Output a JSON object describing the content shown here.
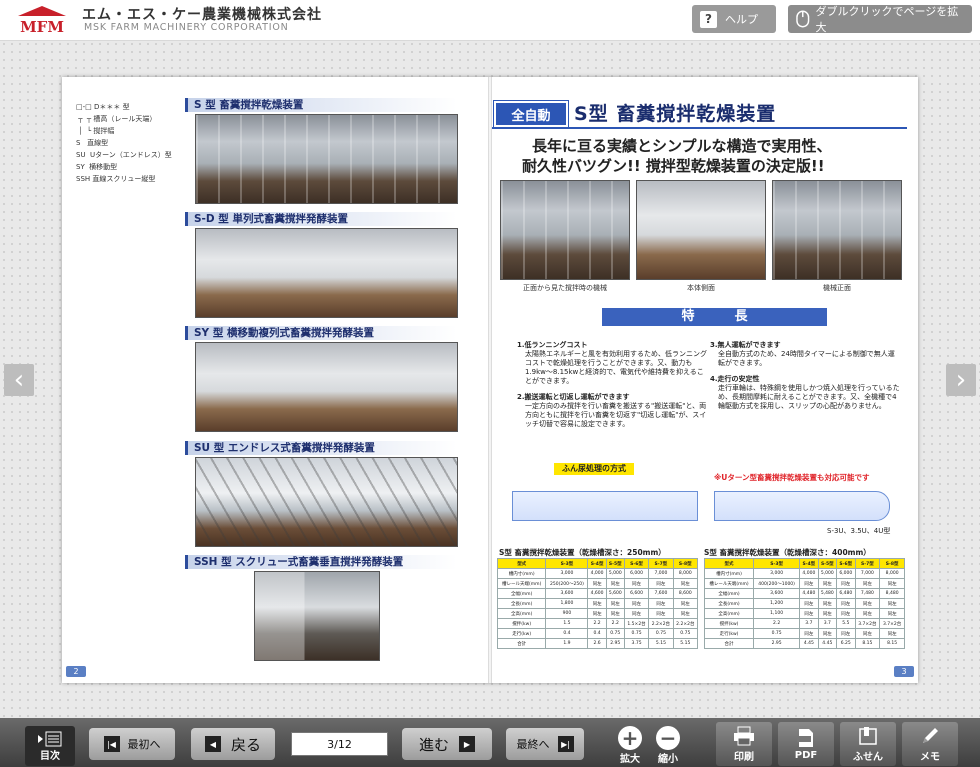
{
  "header": {
    "logo_text": "MFM",
    "company_jp": "エム・エス・ケー農業機械株式会社",
    "company_en": "MSK FARM MACHINERY CORPORATION",
    "help_label": "ヘルプ",
    "zoom_hint_label": "ダブルクリックでページを拡大",
    "colors": {
      "logo_red": "#c8202a",
      "button_gray": "#9a9a9a"
    }
  },
  "left_page": {
    "legend": "□-□ D＊＊＊ 型\n ┬  ┬ 槽高（レール天端）\n │  └ 撹拌幅\nS   直線型\nSU  Uターン（エンドレス）型\nSY  横移動型\nSSH 直線スクリュー縦型",
    "sections": [
      {
        "title": "S 型 畜糞撹拌乾燥装置"
      },
      {
        "title": "S-D 型 単列式畜糞撹拌発酵装置"
      },
      {
        "title": "SY 型 横移動複列式畜糞撹拌発酵装置"
      },
      {
        "title": "SU 型 エンドレス式畜糞撹拌発酵装置"
      },
      {
        "title": "SSH 型 スクリュー式畜糞垂直撹拌発酵装置"
      }
    ],
    "page_number": "2"
  },
  "right_page": {
    "auto_tag": "全自動",
    "title": "S型 畜糞撹拌乾燥装置",
    "tagline1": "長年に亘る実績とシンプルな構造で実用性、",
    "tagline2": "耐久性バツグン!! 撹拌型乾燥装置の決定版!!",
    "photo_captions": [
      "正面から見た撹拌時の機械",
      "本体側面",
      "機械正面"
    ],
    "features_label": "特長",
    "features": [
      {
        "head": "1.低ランニングコスト",
        "body": "太陽熱エネルギーと風を有効利用するため、低ランニングコストで乾燥処理を行うことができます。又、動力も1.9kw〜8.15kwと経済的で、電気代や維持費を抑えることができます。"
      },
      {
        "head": "2.搬送運転と切返し運転ができます",
        "body": "一定方向のみ撹拌を行い畜糞を搬送する\"搬送運転\"と、両方向ともに撹拌を行い畜糞を切返す\"切返し運転\"が、スイッチ切替で容易に設定できます。"
      },
      {
        "head": "3.無人運転ができます",
        "body": "全自動方式のため、24時間タイマーによる制御で無人運転ができます。"
      },
      {
        "head": "4.走行の安定性",
        "body": "走行車輪は、特殊鋼を使用しかつ焼入処理を行っているため、長期間摩耗に耐えることができます。又、全機種で4輪駆動方式を採用し、スリップの心配がありません。"
      }
    ],
    "manure_tag": "ふん尿処理の方式",
    "u_turn_note": "※Uターン型畜糞撹拌乾燥装置も対応可能です",
    "u_models": "S-3U、3.5U、4U型",
    "table1_title": "S型 畜糞撹拌乾燥装置（乾燥槽深さ：250mm）",
    "table2_title": "S型 畜糞撹拌乾燥装置（乾燥槽深さ：400mm）",
    "table1": {
      "head": [
        "型式",
        "S-3型",
        "S-4型",
        "S-5型",
        "S-6型",
        "S-7型",
        "S-8型"
      ],
      "rows": [
        [
          "槽内寸(mm)",
          "3,000",
          "4,000",
          "5,000",
          "6,000",
          "7,000",
          "8,000"
        ],
        [
          "槽レール天端(mm)",
          "250(200〜250)",
          "同左",
          "同左",
          "同左",
          "同左",
          "同左"
        ],
        [
          "全幅(mm)",
          "3,600",
          "4,600",
          "5,600",
          "6,600",
          "7,600",
          "8,600"
        ],
        [
          "全長(mm)",
          "1,800",
          "同左",
          "同左",
          "同左",
          "同左",
          "同左"
        ],
        [
          "全高(mm)",
          "900",
          "同左",
          "同左",
          "同左",
          "同左",
          "同左"
        ],
        [
          "撹拌(kw)",
          "1.5",
          "2.2",
          "2.2",
          "1.5×2台",
          "2.2×2台",
          "2.2×2台"
        ],
        [
          "走行(kw)",
          "0.4",
          "0.4",
          "0.75",
          "0.75",
          "0.75",
          "0.75"
        ],
        [
          "合計",
          "1.9",
          "2.6",
          "2.95",
          "3.75",
          "5.15",
          "5.15"
        ]
      ]
    },
    "table2": {
      "head": [
        "型式",
        "S-3型",
        "S-4型",
        "S-5型",
        "S-6型",
        "S-7型",
        "S-8型"
      ],
      "rows": [
        [
          "槽内寸(mm)",
          "3,000",
          "4,000",
          "5,000",
          "6,000",
          "7,000",
          "8,000"
        ],
        [
          "槽レール天端(mm)",
          "400(200〜1000)",
          "同左",
          "同左",
          "同左",
          "同左",
          "同左"
        ],
        [
          "全幅(mm)",
          "3,600",
          "4,480",
          "5,480",
          "6,480",
          "7,480",
          "8,480"
        ],
        [
          "全長(mm)",
          "1,200",
          "同左",
          "同左",
          "同左",
          "同左",
          "同左"
        ],
        [
          "全高(mm)",
          "1,100",
          "同左",
          "同左",
          "同左",
          "同左",
          "同左"
        ],
        [
          "撹拌(kw)",
          "2.2",
          "3.7",
          "3.7",
          "5.5",
          "3.7×2台",
          "3.7×2台"
        ],
        [
          "走行(kw)",
          "0.75",
          "同左",
          "同左",
          "同左",
          "同左",
          "同左"
        ],
        [
          "合計",
          "2.95",
          "4.45",
          "4.45",
          "6.25",
          "8.15",
          "8.15"
        ]
      ]
    },
    "page_number": "3"
  },
  "toolbar": {
    "toc_label": "目次",
    "first_label": "最初へ",
    "back_label": "戻る",
    "page_value": "3/12",
    "forward_label": "進む",
    "last_label": "最終へ",
    "zoom_in_label": "拡大",
    "zoom_out_label": "縮小",
    "print_label": "印刷",
    "pdf_label": "PDF",
    "sticky_label": "ふせん",
    "memo_label": "メモ"
  }
}
